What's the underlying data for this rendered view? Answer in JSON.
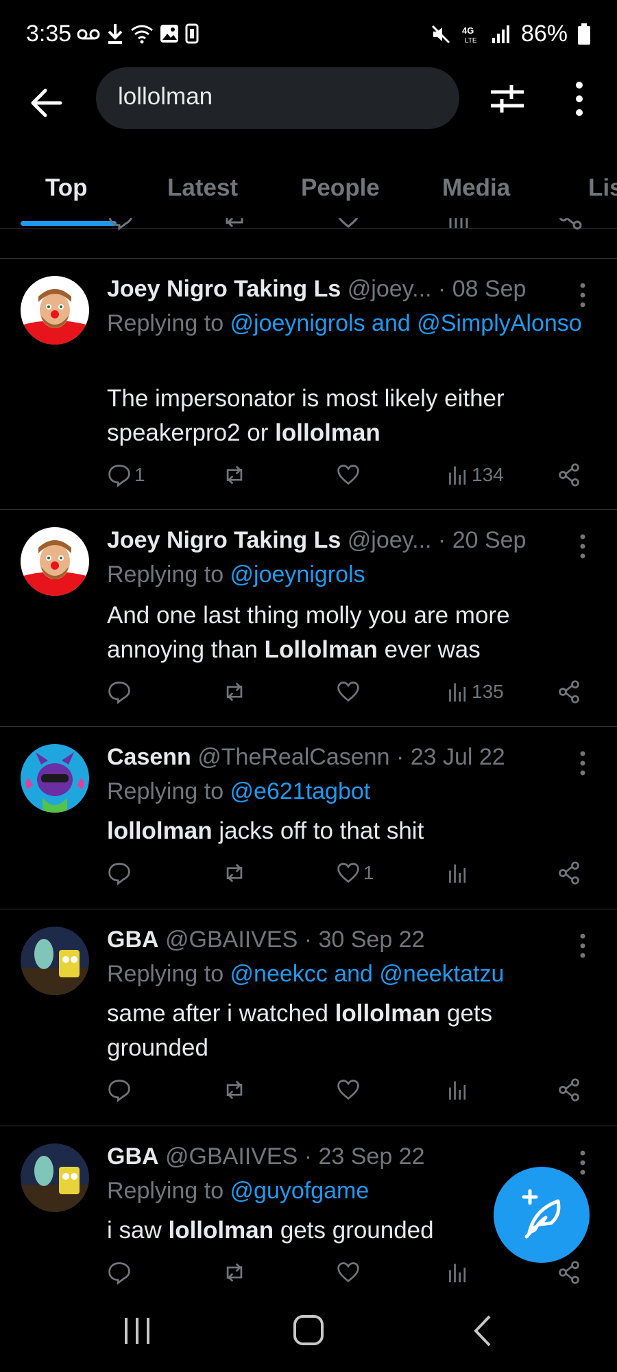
{
  "status_bar": {
    "time": "3:35",
    "battery": "86%"
  },
  "search": {
    "value": "lollolman"
  },
  "tabs": [
    {
      "label": "Top",
      "active": true
    },
    {
      "label": "Latest",
      "active": false
    },
    {
      "label": "People",
      "active": false
    },
    {
      "label": "Media",
      "active": false
    },
    {
      "label": "Lis",
      "active": false
    }
  ],
  "tweets": [
    {
      "name": "Joey Nigro Taking Ls",
      "meta": " @joey... · 08 Sep",
      "replying_prefix": "Replying to ",
      "replying_to": "@joeynigrols and @SimplyAlonso",
      "text_before": "The impersonator is most likely either speakerpro2 or ",
      "text_bold": "lollolman",
      "text_after": "",
      "reply_count": "1",
      "like_count": "",
      "view_count": "134"
    },
    {
      "name": "Joey Nigro Taking Ls",
      "meta": " @joey... · 20 Sep",
      "replying_prefix": "Replying to ",
      "replying_to": "@joeynigrols",
      "text_before": "And one last thing molly you are more annoying than ",
      "text_bold": "Lollolman",
      "text_after": " ever was",
      "reply_count": "",
      "like_count": "",
      "view_count": "135"
    },
    {
      "name": "Casenn",
      "meta": " @TheRealCasenn · 23 Jul 22",
      "replying_prefix": "Replying to ",
      "replying_to": "@e621tagbot",
      "text_before": "",
      "text_bold": "lollolman",
      "text_after": " jacks off to that shit",
      "reply_count": "",
      "like_count": "1",
      "view_count": ""
    },
    {
      "name": "GBA",
      "meta": " @GBAIIVES · 30 Sep 22",
      "replying_prefix": "Replying to ",
      "replying_to": "@neekcc and @neektatzu",
      "text_before": "same after i watched ",
      "text_bold": "lollolman",
      "text_after": " gets grounded",
      "reply_count": "",
      "like_count": "",
      "view_count": ""
    },
    {
      "name": "GBA",
      "meta": " @GBAIIVES · 23 Sep 22",
      "replying_prefix": "Replying to ",
      "replying_to": "@guyofgame",
      "text_before": "i saw ",
      "text_bold": "lollolman",
      "text_after": " gets grounded",
      "reply_count": "",
      "like_count": "",
      "view_count": ""
    }
  ],
  "colors": {
    "accent": "#1d9bf0",
    "background": "#000000",
    "muted": "#71767b",
    "divider": "#2f3336"
  }
}
